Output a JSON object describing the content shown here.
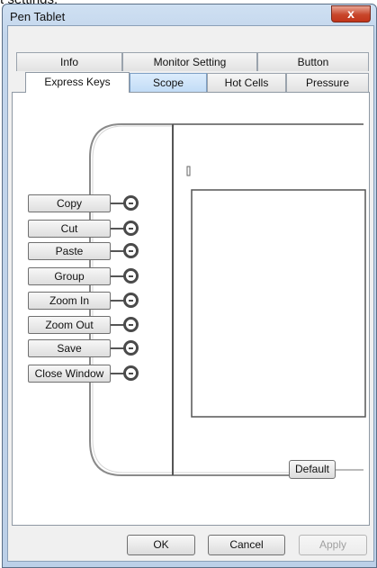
{
  "top_fragment": "t settings.",
  "window": {
    "title": "Pen Tablet",
    "close_glyph": "x"
  },
  "tabs_row1": [
    "Info",
    "Monitor Setting",
    "Button"
  ],
  "tabs_row2": [
    "Express Keys",
    "Scope",
    "Hot Cells",
    "Pressure"
  ],
  "express_keys": [
    "Copy",
    "Cut",
    "Paste",
    "Group",
    "Zoom In",
    "Zoom Out",
    "Save",
    "Close Window"
  ],
  "default_button": "Default",
  "dialog_buttons": {
    "ok": "OK",
    "cancel": "Cancel",
    "apply": "Apply"
  }
}
